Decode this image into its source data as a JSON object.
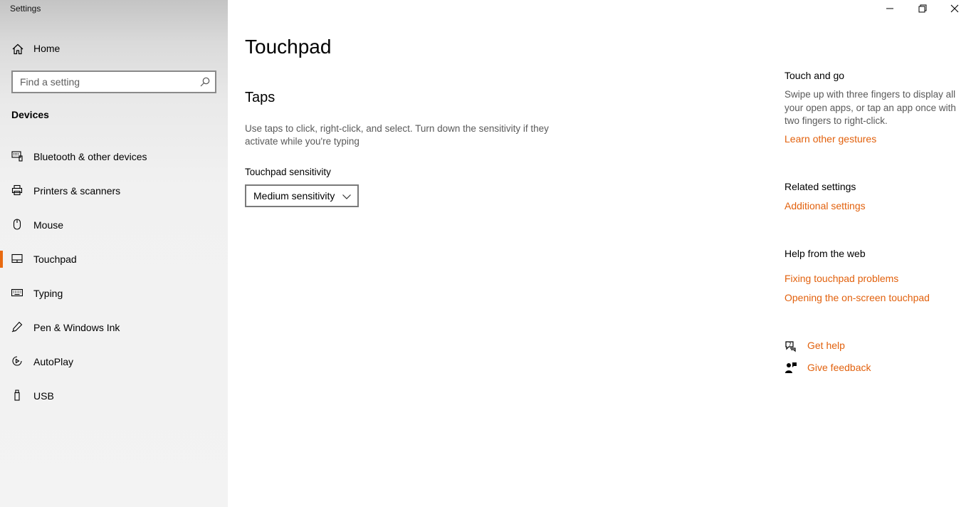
{
  "app": {
    "title": "Settings"
  },
  "sidebar": {
    "home_label": "Home",
    "search_placeholder": "Find a setting",
    "section_heading": "Devices",
    "items": [
      {
        "label": "Bluetooth & other devices",
        "icon": "bluetooth-devices-icon",
        "active": false
      },
      {
        "label": "Printers & scanners",
        "icon": "printer-icon",
        "active": false
      },
      {
        "label": "Mouse",
        "icon": "mouse-icon",
        "active": false
      },
      {
        "label": "Touchpad",
        "icon": "touchpad-icon",
        "active": true
      },
      {
        "label": "Typing",
        "icon": "keyboard-icon",
        "active": false
      },
      {
        "label": "Pen & Windows Ink",
        "icon": "pen-icon",
        "active": false
      },
      {
        "label": "AutoPlay",
        "icon": "autoplay-icon",
        "active": false
      },
      {
        "label": "USB",
        "icon": "usb-icon",
        "active": false
      }
    ]
  },
  "main": {
    "title": "Touchpad",
    "taps": {
      "heading": "Taps",
      "description": "Use taps to click, right-click, and select. Turn down the sensitivity if they activate while you're typing",
      "sensitivity_label": "Touchpad sensitivity",
      "sensitivity_value": "Medium sensitivity"
    }
  },
  "right_panel": {
    "touch_and_go": {
      "heading": "Touch and go",
      "text": "Swipe up with three fingers to display all your open apps, or tap an app once with two fingers to right-click.",
      "link": "Learn other gestures"
    },
    "related": {
      "heading": "Related settings",
      "link": "Additional settings"
    },
    "help_web": {
      "heading": "Help from the web",
      "links": [
        "Fixing touchpad problems",
        "Opening the on-screen touchpad"
      ]
    },
    "get_help": "Get help",
    "give_feedback": "Give feedback"
  },
  "colors": {
    "accent": "#e86a10",
    "link": "#e2610d",
    "sidebar_bg": "#f3f3f3"
  }
}
